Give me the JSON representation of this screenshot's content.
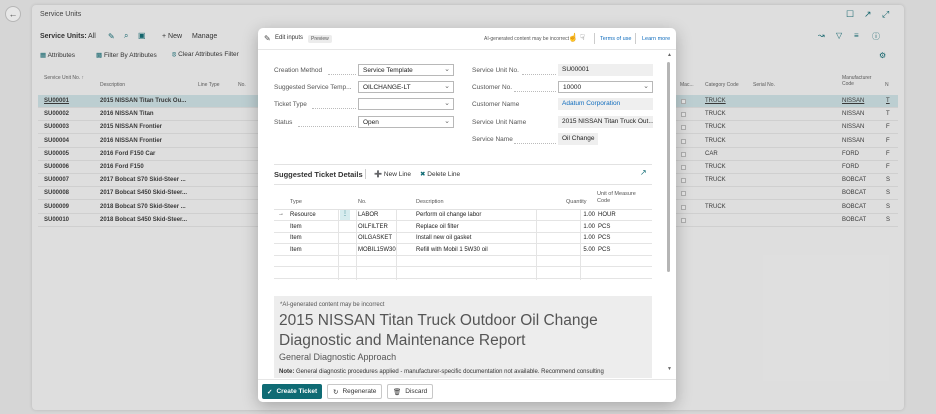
{
  "background": {
    "title": "Service Units",
    "filter_label": "Service Units:",
    "filter_value": "All",
    "new_label": "+ New",
    "manage_label": "Manage",
    "attributes_label": "Attributes",
    "filter_by_attributes_label": "Filter By Attributes",
    "clear_attributes_filter_label": "Clear Attributes Filter",
    "columns": {
      "no": "Service Unit No. ↑",
      "description": "Description",
      "line_type": "Line Type",
      "line_no": "No.",
      "mac": "Mac...",
      "category_code": "Category Code",
      "serial_no": "Serial No.",
      "manufacturer_code": "Manufacturer Code"
    },
    "rows": [
      {
        "no": "SU00001",
        "description": "2015 NISSAN Titan Truck Ou...",
        "category": "TRUCK",
        "manufacturer": "NISSAN",
        "extra": "T"
      },
      {
        "no": "SU00002",
        "description": "2016 NISSAN Titan",
        "category": "TRUCK",
        "manufacturer": "NISSAN",
        "extra": "T"
      },
      {
        "no": "SU00003",
        "description": "2015 NISSAN Frontier",
        "category": "TRUCK",
        "manufacturer": "NISSAN",
        "extra": "F"
      },
      {
        "no": "SU00004",
        "description": "2016 NISSAN Frontier",
        "category": "TRUCK",
        "manufacturer": "NISSAN",
        "extra": "F"
      },
      {
        "no": "SU00005",
        "description": "2016 Ford F150 Car",
        "category": "CAR",
        "manufacturer": "FORD",
        "extra": "F"
      },
      {
        "no": "SU00006",
        "description": "2016 Ford F150",
        "category": "TRUCK",
        "manufacturer": "FORD",
        "extra": "F"
      },
      {
        "no": "SU00007",
        "description": "2017 Bobcat S70 Skid-Steer ...",
        "category": "TRUCK",
        "manufacturer": "BOBCAT",
        "extra": "S"
      },
      {
        "no": "SU00008",
        "description": "2017 Bobcat S450 Skid-Steer...",
        "category": "",
        "manufacturer": "BOBCAT",
        "extra": "S"
      },
      {
        "no": "SU00009",
        "description": "2018 Bobcat S70 Skid-Steer ...",
        "category": "TRUCK",
        "manufacturer": "BOBCAT",
        "extra": "S"
      },
      {
        "no": "SU00010",
        "description": "2018 Bobcat S450 Skid-Steer...",
        "category": "",
        "manufacturer": "BOBCAT",
        "extra": "S"
      }
    ]
  },
  "modal": {
    "edit_inputs": "Edit inputs",
    "preview_badge": "Preview",
    "ai_notice": "AI-generated content may be incorrect",
    "terms": "Terms of use",
    "learn_more": "Learn more",
    "fields": {
      "creation_method": {
        "label": "Creation Method",
        "value": "Service Template"
      },
      "suggested_template": {
        "label": "Suggested Service Temp...",
        "value": "OILCHANGE-LT"
      },
      "ticket_type": {
        "label": "Ticket Type",
        "value": ""
      },
      "status": {
        "label": "Status",
        "value": "Open"
      },
      "service_unit_no": {
        "label": "Service Unit No.",
        "value": "SU00001"
      },
      "customer_no": {
        "label": "Customer No.",
        "value": "10000"
      },
      "customer_name": {
        "label": "Customer Name",
        "value": "Adatum Corporation"
      },
      "service_unit_name": {
        "label": "Service Unit Name",
        "value": "2015 NISSAN Titan Truck Out..."
      },
      "service_name": {
        "label": "Service Name",
        "value": "Oil Change"
      }
    },
    "lines": {
      "title": "Suggested Ticket Details",
      "new_line": "New Line",
      "delete_line": "Delete Line",
      "headers": {
        "type": "Type",
        "no": "No.",
        "description": "Description",
        "quantity": "Quantity",
        "uom": "Unit of Measure Code"
      },
      "rows": [
        {
          "type": "Resource",
          "no": "LABOR",
          "description": "Perform oil change labor",
          "quantity": "1.00",
          "uom": "HOUR"
        },
        {
          "type": "Item",
          "no": "OILFILTER",
          "description": "Replace oil filter",
          "quantity": "1.00",
          "uom": "PCS"
        },
        {
          "type": "Item",
          "no": "OILGASKET",
          "description": "Install new oil gasket",
          "quantity": "1.00",
          "uom": "PCS"
        },
        {
          "type": "Item",
          "no": "MOBIL15W30",
          "description": "Refill with Mobil 1 5W30 oil",
          "quantity": "5.00",
          "uom": "PCS"
        }
      ]
    },
    "report": {
      "notice": "*AI-generated content may be incorrect",
      "title": "2015 NISSAN Titan Truck Outdoor Oil Change Diagnostic and Maintenance Report",
      "subtitle": "General Diagnostic Approach",
      "note_label": "Note:",
      "note_text": "General diagnostic procedures applied - manufacturer-specific documentation not available. Recommend consulting"
    },
    "footer": {
      "create": "Create Ticket",
      "regenerate": "Regenerate",
      "discard": "Discard"
    }
  },
  "colors": {
    "accent": "#0f6b74",
    "link": "#0f6cbd",
    "selected_row": "#cfe3e6"
  }
}
